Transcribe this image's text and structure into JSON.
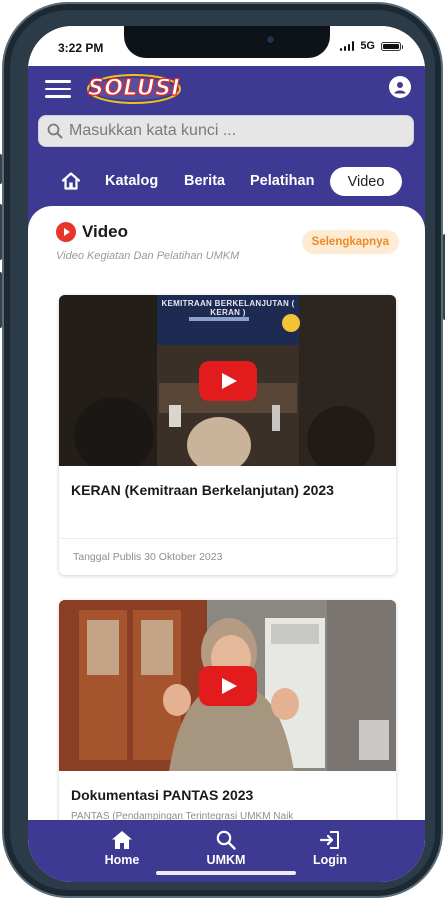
{
  "status_bar": {
    "time": "3:22 PM",
    "network": "5G"
  },
  "header": {
    "logo_text": "SOLUSI",
    "search": {
      "placeholder": "Masukkan kata kunci ..."
    },
    "nav": {
      "items": [
        "Katalog",
        "Berita",
        "Pelatihan"
      ],
      "active": "Video"
    }
  },
  "section": {
    "title": "Video",
    "subtitle": "Video Kegiatan Dan Pelatihan UMKM",
    "more_label": "Selengkapnya"
  },
  "videos": [
    {
      "title": "KERAN (Kemitraan Berkelanjutan) 2023",
      "thumb_caption": "KEMITRAAN BERKELANJUTAN ( KERAN )",
      "date": "Tanggal Publis 30 Oktober 2023"
    },
    {
      "title": "Dokumentasi PANTAS 2023",
      "description": "PANTAS (Pendampingan Terintegrasi UMKM Naik"
    }
  ],
  "bottom_nav": {
    "items": [
      {
        "label": "Home",
        "icon": "home-icon"
      },
      {
        "label": "UMKM",
        "icon": "search-icon"
      },
      {
        "label": "Login",
        "icon": "login-icon"
      }
    ]
  },
  "colors": {
    "primary": "#3e3a93",
    "accent_red": "#e32826",
    "badge_orange": "#f08a24",
    "badge_bg": "#fdebd3"
  }
}
